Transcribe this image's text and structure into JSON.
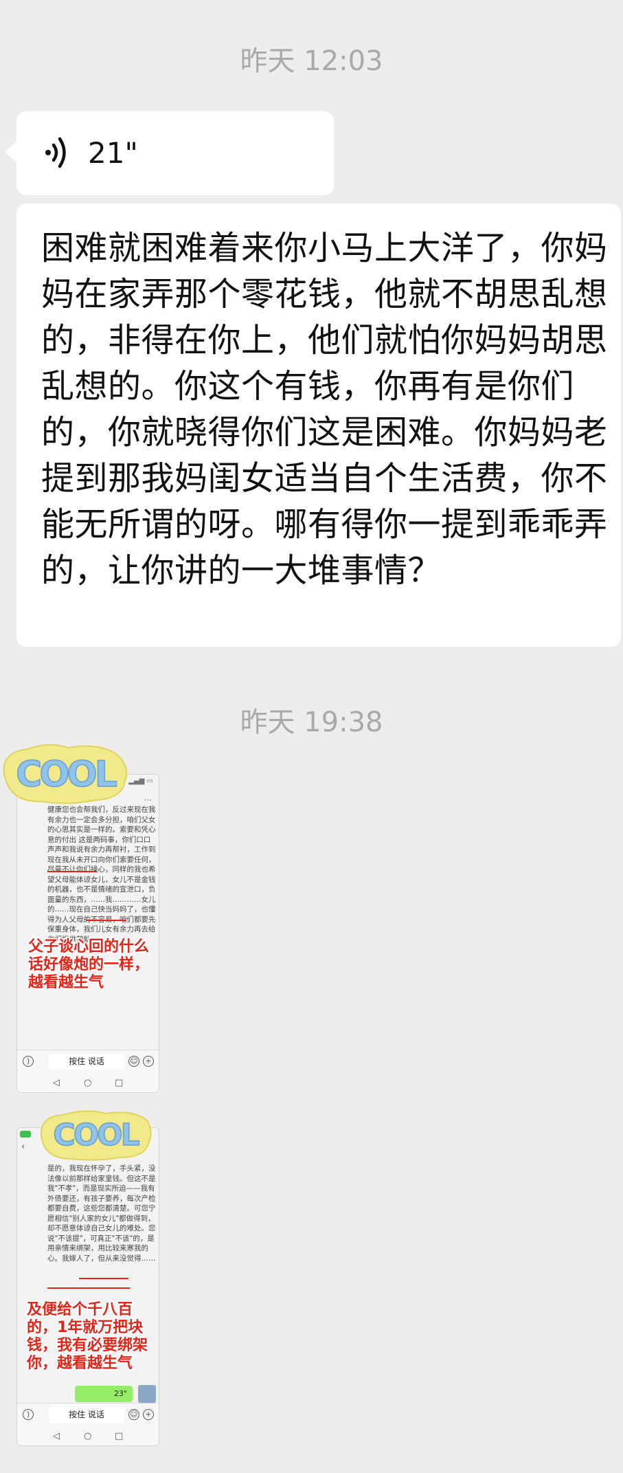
{
  "timestamps": [
    "昨天 12:03",
    "昨天 19:38"
  ],
  "voice_message": {
    "duration": "21\"",
    "icon": "voice-wave-icon"
  },
  "text_message": "困难就困难着来你小马上大洋了，你妈妈在家弄那个零花钱，他就不胡思乱想的，非得在你上，他们就怕你妈妈胡思乱想的。你这个有钱，你再有是你们的，你就晓得你们这是困难。你妈妈老提到那我妈闺女适当自个生活费，你不能无所谓的呀。哪有得你一提到乖乖弄的，让你讲的一大堆事情？",
  "image1": {
    "sticker": "COOL",
    "doc_text": "健康您也会帮我们，反过来现在我有余力也一定会多分担，咱们父女的心思其实是一样的。索要和凭心意的付出 这是两码事，你们口口声声和我说有余力再帮衬，工作到现在我从未开口向你们索要任何，尽量不让你们操心，同样的我也希望父母能体谅女儿，女儿不是金钱的机器，也不是情绪的宣泄口，负面量的东西，……我…………女儿的……现在自己快当妈妈了，也懂得为人父母的不容易，咱们都要先保重身体，我们儿女有余力再去给你们提供帮助",
    "overlay": "父子谈心回的什么话好像炮的一样，越看越生气",
    "chat_hold": "按住 说话"
  },
  "image2": {
    "sticker": "COOL",
    "doc_text": "是的，我现在怀孕了，手头紧，没法像以前那样给家里钱。但这不是我\"不孝\"，而是现实所迫——我有外债要还，有孩子要养，每次产检都要自费，这些您都清楚。可您宁愿相信\"别人家的女儿\"都做得到，却不愿意体谅自己女儿的难处。您说\"不该提\"，可真正\"不该\"的，是用亲情来绑架，用比较来寒我的心。我嫁人了，但从来没觉得……",
    "overlay": "及便给个千八百的，1年就万把块钱，我有必要绑架你，越看越生气",
    "voice_badge": "23\"",
    "chat_hold": "按住 说话"
  },
  "colors": {
    "background": "#ededed",
    "bubble": "#ffffff",
    "timestamp": "#a9a9a9",
    "overlay_text": "#e32416",
    "sticker_fill": "#f2ea8a"
  }
}
